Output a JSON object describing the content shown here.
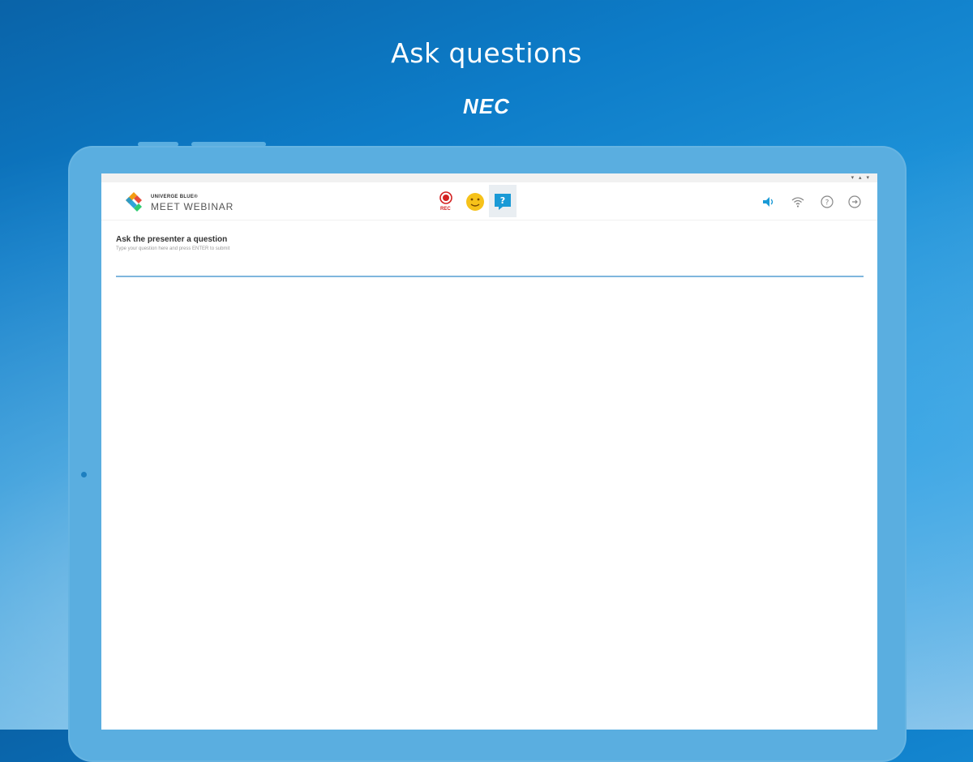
{
  "headline": "Ask questions",
  "brand": "NEC",
  "app": {
    "logo_top": "UNIVERGE BLUE®",
    "logo_main": "MEET WEBINAR",
    "rec_label": "REC"
  },
  "status_icons": "▾ ▴ ▾",
  "question_panel": {
    "title": "Ask the presenter a question",
    "hint": "Type your question here and press ENTER to submit",
    "input_value": ""
  },
  "colors": {
    "accent": "#1a9ad6",
    "record": "#d32020",
    "emoji": "#f6c21a",
    "input_underline": "#7fb6dd"
  },
  "icons": {
    "record": "record-icon",
    "emoji": "emoji-reaction-icon",
    "questions": "question-chat-icon",
    "volume": "volume-icon",
    "wifi": "wifi-icon",
    "help": "help-icon",
    "exit": "exit-icon"
  }
}
